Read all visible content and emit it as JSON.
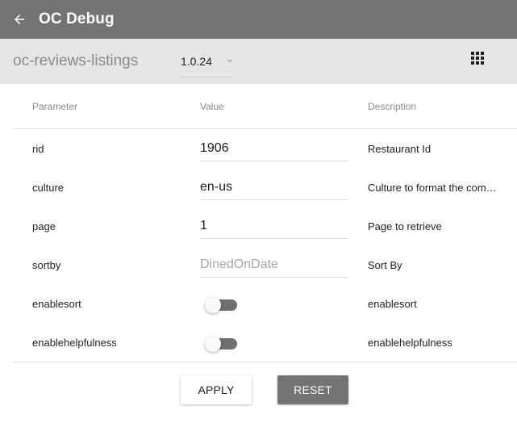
{
  "app_bar": {
    "title": "OC Debug",
    "back_icon": "arrow-back-icon",
    "background": "#737373"
  },
  "component_bar": {
    "name": "oc-reviews-listings",
    "version": "1.0.24",
    "apps_icon": "apps-grid-icon",
    "background": "#e6e6e6"
  },
  "table": {
    "headers": {
      "parameter": "Parameter",
      "value": "Value",
      "description": "Description"
    },
    "rows": [
      {
        "param": "rid",
        "type": "text",
        "value": "1906",
        "placeholder": "",
        "description": "Restaurant Id"
      },
      {
        "param": "culture",
        "type": "text",
        "value": "en-us",
        "placeholder": "",
        "description": "Culture to format the comment dates"
      },
      {
        "param": "page",
        "type": "text",
        "value": "1",
        "placeholder": "",
        "description": "Page to retrieve"
      },
      {
        "param": "sortby",
        "type": "text",
        "value": "",
        "placeholder": "DinedOnDate",
        "description": "Sort By"
      },
      {
        "param": "enablesort",
        "type": "toggle",
        "checked": false,
        "description": "enablesort"
      },
      {
        "param": "enablehelpfulness",
        "type": "toggle",
        "checked": false,
        "description": "enablehelpfulness"
      }
    ]
  },
  "actions": {
    "apply_label": "APPLY",
    "reset_label": "RESET",
    "reset_color": "#737373"
  }
}
